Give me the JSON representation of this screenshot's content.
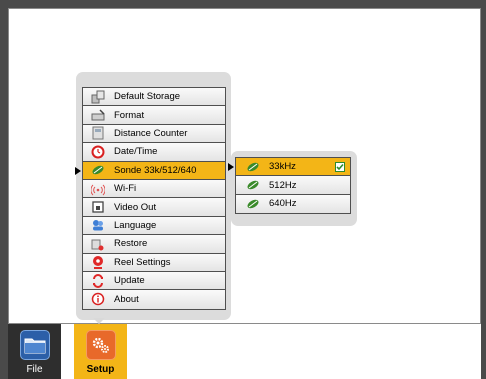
{
  "colors": {
    "accent": "#f3b517",
    "file_tab_bg": "#2e2e2e",
    "panel_bg": "#dcdcdc",
    "check": "#2e8b2e"
  },
  "menu": {
    "items": [
      {
        "label": "Default Storage",
        "icon": "storage-icon"
      },
      {
        "label": "Format",
        "icon": "format-icon"
      },
      {
        "label": "Distance Counter",
        "icon": "distance-counter-icon"
      },
      {
        "label": "Date/Time",
        "icon": "clock-icon"
      },
      {
        "label": "Sonde 33k/512/640",
        "icon": "sonde-icon",
        "selected": true
      },
      {
        "label": "Wi-Fi",
        "icon": "wifi-icon"
      },
      {
        "label": "Video Out",
        "icon": "video-out-icon"
      },
      {
        "label": "Language",
        "icon": "language-icon"
      },
      {
        "label": "Restore",
        "icon": "restore-icon"
      },
      {
        "label": "Reel Settings",
        "icon": "reel-icon"
      },
      {
        "label": "Update",
        "icon": "update-icon"
      },
      {
        "label": "About",
        "icon": "info-icon"
      }
    ]
  },
  "submenu": {
    "items": [
      {
        "label": "33kHz",
        "icon": "sonde-icon",
        "selected": true,
        "checked": true
      },
      {
        "label": "512Hz",
        "icon": "sonde-icon"
      },
      {
        "label": "640Hz",
        "icon": "sonde-icon"
      }
    ]
  },
  "dock": {
    "file_label": "File",
    "setup_label": "Setup"
  }
}
